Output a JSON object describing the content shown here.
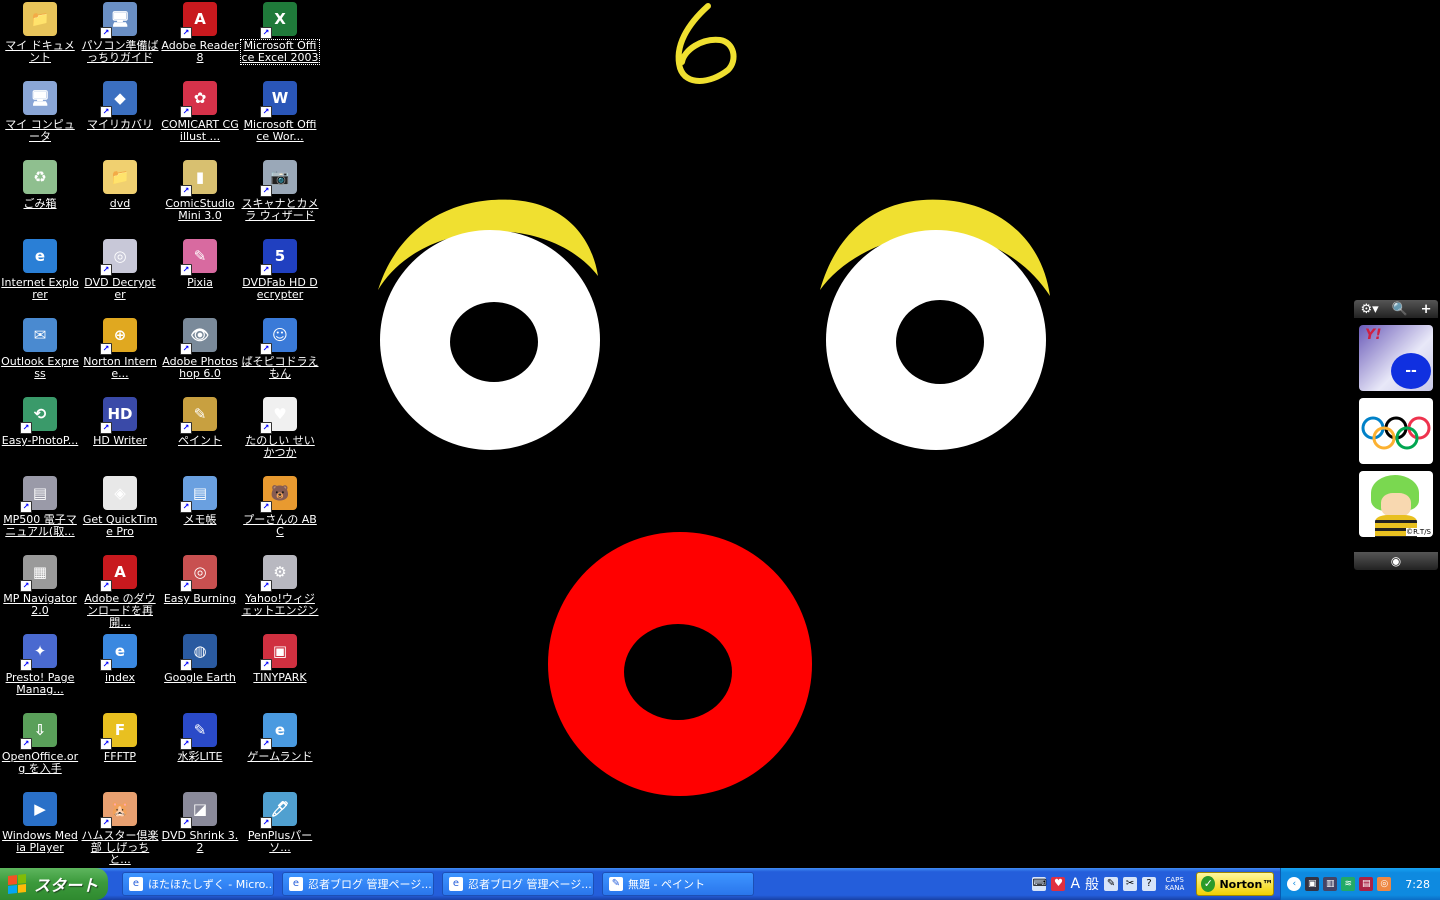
{
  "desktop": {
    "icons": [
      {
        "label": "マイ ドキュメント",
        "glyph": "📁",
        "bg": "#e8c45a",
        "shortcut": false,
        "selected": false
      },
      {
        "label": "パソコン準備ばっちりガイド",
        "glyph": "🖥",
        "bg": "#6a8fc4",
        "shortcut": true,
        "selected": false
      },
      {
        "label": "Adobe Reader 8",
        "glyph": "A",
        "bg": "#c8191e",
        "shortcut": true,
        "selected": false
      },
      {
        "label": "Microsoft Office Excel 2003",
        "glyph": "X",
        "bg": "#1f7a3a",
        "shortcut": true,
        "selected": true
      },
      {
        "label": "マイ コンピュータ",
        "glyph": "🖥",
        "bg": "#8aa6d6",
        "shortcut": false,
        "selected": false
      },
      {
        "label": "マイリカバリ",
        "glyph": "◆",
        "bg": "#3b6fc0",
        "shortcut": true,
        "selected": false
      },
      {
        "label": "COMICART CG illust ...",
        "glyph": "✿",
        "bg": "#d6324a",
        "shortcut": true,
        "selected": false
      },
      {
        "label": "Microsoft Office Wor...",
        "glyph": "W",
        "bg": "#2a56b8",
        "shortcut": true,
        "selected": false
      },
      {
        "label": "ごみ箱",
        "glyph": "♻",
        "bg": "#8fbf8f",
        "shortcut": false,
        "selected": false
      },
      {
        "label": "dvd",
        "glyph": "📁",
        "bg": "#f0d070",
        "shortcut": false,
        "selected": false
      },
      {
        "label": "ComicStudio Mini 3.0",
        "glyph": "▮",
        "bg": "#d8c070",
        "shortcut": true,
        "selected": false
      },
      {
        "label": "スキャナとカメラ ウィザード",
        "glyph": "📷",
        "bg": "#9aa8b8",
        "shortcut": true,
        "selected": false
      },
      {
        "label": "Internet Explorer",
        "glyph": "e",
        "bg": "#2a7fd6",
        "shortcut": false,
        "selected": false
      },
      {
        "label": "DVD Decrypter",
        "glyph": "◎",
        "bg": "#c8c8d8",
        "shortcut": true,
        "selected": false
      },
      {
        "label": "Pixia",
        "glyph": "✎",
        "bg": "#d86aa0",
        "shortcut": true,
        "selected": false
      },
      {
        "label": "DVDFab HD Decrypter",
        "glyph": "5",
        "bg": "#2040c0",
        "shortcut": true,
        "selected": false
      },
      {
        "label": "Outlook Express",
        "glyph": "✉",
        "bg": "#4a8ad0",
        "shortcut": false,
        "selected": false
      },
      {
        "label": "Norton Interne...",
        "glyph": "⊕",
        "bg": "#e0a820",
        "shortcut": true,
        "selected": false
      },
      {
        "label": "Adobe Photoshop 6.0",
        "glyph": "👁",
        "bg": "#7a8a9a",
        "shortcut": true,
        "selected": false
      },
      {
        "label": "ぱそピコドラえもん",
        "glyph": "☺",
        "bg": "#3a7ad8",
        "shortcut": true,
        "selected": false
      },
      {
        "label": "Easy-PhotoP...",
        "glyph": "⟲",
        "bg": "#3a9a6a",
        "shortcut": true,
        "selected": false
      },
      {
        "label": "HD Writer",
        "glyph": "HD",
        "bg": "#3a4aa8",
        "shortcut": true,
        "selected": false
      },
      {
        "label": "ペイント",
        "glyph": "✎",
        "bg": "#c8a040",
        "shortcut": true,
        "selected": false
      },
      {
        "label": "たのしい せいかつか",
        "glyph": "♥",
        "bg": "#f0f0f0",
        "shortcut": true,
        "selected": false
      },
      {
        "label": "MP500 電子マニュアル(取...",
        "glyph": "▤",
        "bg": "#9a9aa8",
        "shortcut": true,
        "selected": false
      },
      {
        "label": "Get QuickTime Pro",
        "glyph": "◈",
        "bg": "#e8e8e8",
        "shortcut": false,
        "selected": false
      },
      {
        "label": "メモ帳",
        "glyph": "▤",
        "bg": "#6aa0e0",
        "shortcut": true,
        "selected": false
      },
      {
        "label": "プーさんの ABC",
        "glyph": "🐻",
        "bg": "#e89a30",
        "shortcut": true,
        "selected": false
      },
      {
        "label": "MP Navigator 2.0",
        "glyph": "▦",
        "bg": "#9a9a9a",
        "shortcut": true,
        "selected": false
      },
      {
        "label": "Adobe のダウンロードを再開...",
        "glyph": "A",
        "bg": "#c8191e",
        "shortcut": true,
        "selected": false
      },
      {
        "label": "Easy Burning",
        "glyph": "◎",
        "bg": "#c85050",
        "shortcut": true,
        "selected": false
      },
      {
        "label": "Yahoo!ウィジェットエンジン",
        "glyph": "⚙",
        "bg": "#b8b8c0",
        "shortcut": true,
        "selected": false
      },
      {
        "label": "Presto! PageManag...",
        "glyph": "✦",
        "bg": "#4a6ad0",
        "shortcut": true,
        "selected": false
      },
      {
        "label": "index",
        "glyph": "e",
        "bg": "#3a88e0",
        "shortcut": true,
        "selected": false
      },
      {
        "label": "Google Earth",
        "glyph": "◍",
        "bg": "#2a5aa0",
        "shortcut": true,
        "selected": false
      },
      {
        "label": "TINYPARK",
        "glyph": "▣",
        "bg": "#d03040",
        "shortcut": true,
        "selected": false
      },
      {
        "label": "OpenOffice.org を入手",
        "glyph": "⇩",
        "bg": "#5aa05a",
        "shortcut": true,
        "selected": false
      },
      {
        "label": "FFFTP",
        "glyph": "F",
        "bg": "#e8c020",
        "shortcut": true,
        "selected": false
      },
      {
        "label": "水彩LITE",
        "glyph": "✎",
        "bg": "#2a4ac8",
        "shortcut": true,
        "selected": false
      },
      {
        "label": "ゲームランド",
        "glyph": "e",
        "bg": "#4a9ae0",
        "shortcut": true,
        "selected": false
      },
      {
        "label": "Windows Media Player",
        "glyph": "▶",
        "bg": "#2a70c8",
        "shortcut": false,
        "selected": false
      },
      {
        "label": "ハムスター倶楽部 しげっちと...",
        "glyph": "🐹",
        "bg": "#e8a070",
        "shortcut": true,
        "selected": false
      },
      {
        "label": "DVD Shrink 3.2",
        "glyph": "◪",
        "bg": "#8a8a9a",
        "shortcut": true,
        "selected": false
      },
      {
        "label": "PenPlusパーソ...",
        "glyph": "🖊",
        "bg": "#50a0d0",
        "shortcut": true,
        "selected": false
      }
    ]
  },
  "wallpaper": {
    "colors": {
      "background": "#000000",
      "eyes": "#ffffff",
      "brows": "#f0e030",
      "mouth": "#ff0000",
      "pupil": "#000000"
    }
  },
  "gadgets": {
    "toolbar": {
      "settings": "⚙▾",
      "search": "🔍",
      "add": "+"
    },
    "yahoo": {
      "logo": "Y!",
      "badge": "--"
    },
    "character_copyright": "©R.T/S",
    "bottom_icon": "◉"
  },
  "taskbar": {
    "start_label": "スタート",
    "tasks": [
      {
        "label": "ほたほたしずく - Micro...",
        "icon": "e"
      },
      {
        "label": "忍者ブログ 管理ページ...",
        "icon": "e"
      },
      {
        "label": "忍者ブログ 管理ページ...",
        "icon": "e"
      },
      {
        "label": "無題 - ペイント",
        "icon": "✎"
      }
    ],
    "language": {
      "mode": "A",
      "ime": "般"
    },
    "caps": "CAPS",
    "kana": "KANA",
    "norton_label": "Norton™",
    "clock": "7:28",
    "colors": {
      "taskbar": "#245edb",
      "start": "#3c9a3c",
      "tray": "#0e8ae0"
    }
  }
}
